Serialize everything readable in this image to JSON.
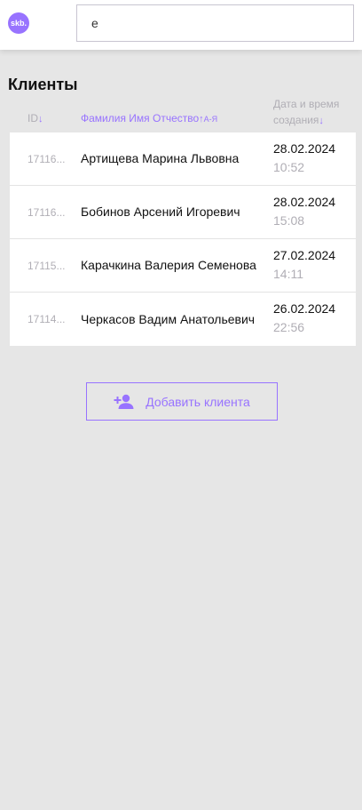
{
  "header": {
    "logo_text": "skb.",
    "search": {
      "value": "е",
      "placeholder": ""
    }
  },
  "page_title": "Клиенты",
  "columns": {
    "id": {
      "label": "ID",
      "arrow": "↓"
    },
    "name": {
      "label": "Фамилия Имя Отчество",
      "arrow": "↑",
      "sort_hint": "А-Я"
    },
    "created": {
      "label_line1": "Дата и время",
      "label_line2": "создания",
      "arrow": "↓"
    }
  },
  "clients": [
    {
      "id": "17116...",
      "name": "Артищева Марина Львовна",
      "date": "28.02.2024",
      "time": "10:52"
    },
    {
      "id": "17116...",
      "name": "Бобинов Арсений Игоревич",
      "date": "28.02.2024",
      "time": "15:08"
    },
    {
      "id": "17115...",
      "name": "Карачкина Валерия Семенова",
      "date": "27.02.2024",
      "time": "14:11"
    },
    {
      "id": "17114...",
      "name": "Черкасов Вадим Анатольевич",
      "date": "26.02.2024",
      "time": "22:56"
    }
  ],
  "add_button": {
    "label": "Добавить клиента",
    "icon": "add-user-icon"
  },
  "colors": {
    "accent": "#9873ff",
    "muted": "#b0aeb5",
    "background": "#e6e6e6"
  }
}
